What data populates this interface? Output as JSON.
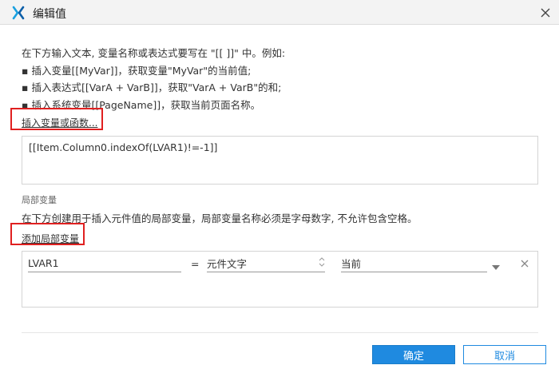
{
  "window": {
    "title": "编辑值",
    "app_icon": "axure-x-icon",
    "close_icon": "close-icon"
  },
  "intro": {
    "line1": "在下方输入文本, 变量名称或表达式要写在 \"[[ ]]\" 中。例如:",
    "line2": "▪ 插入变量[[MyVar]]，获取变量\"MyVar\"的当前值;",
    "line3": "▪ 插入表达式[[VarA + VarB]]，获取\"VarA + VarB\"的和;",
    "line4": "▪ 插入系统变量[[PageName]]，获取当前页面名称。"
  },
  "insert_link": "插入变量或函数...",
  "expression": "[[Item.Column0.indexOf(LVAR1)!=-1]]",
  "local_vars": {
    "section_label": "局部变量",
    "description": "在下方创建用于插入元件值的局部变量，局部变量名称必须是字母数字, 不允许包含空格。",
    "add_link": "添加局部变量",
    "rows": [
      {
        "name": "LVAR1",
        "equals": "=",
        "type": "元件文字",
        "target": "当前"
      }
    ]
  },
  "buttons": {
    "ok": "确定",
    "cancel": "取消"
  },
  "colors": {
    "accent": "#1f8ae0",
    "highlight_box": "#e02020",
    "titlebar_bg": "#f3f3f3"
  }
}
